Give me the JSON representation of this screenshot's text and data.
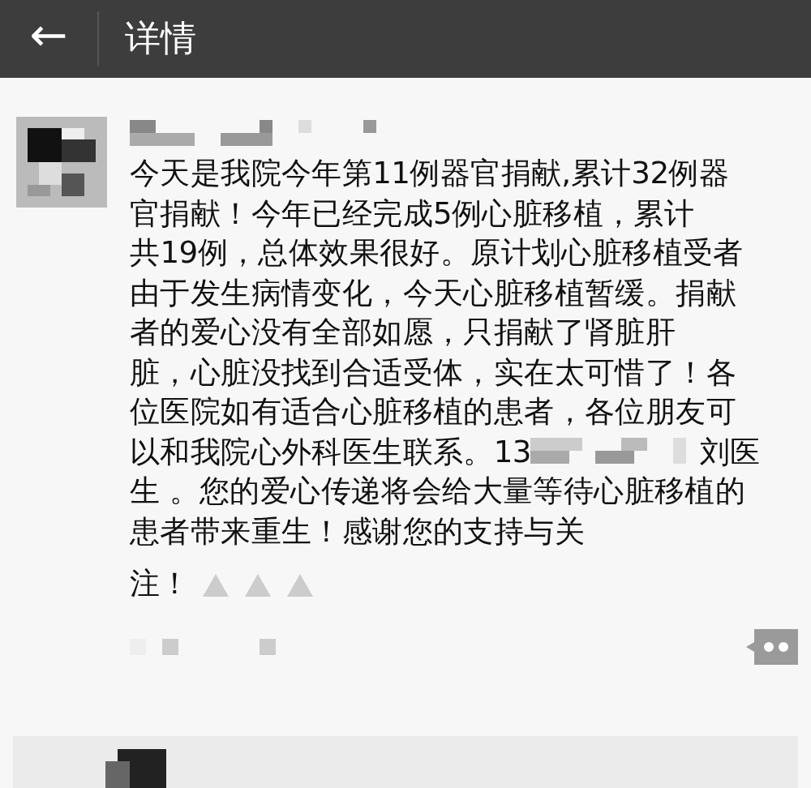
{
  "header": {
    "back": "←",
    "title": "详情"
  },
  "post": {
    "lines": [
      {
        "text": "今天是我院今年第11例器官捐献,累计32例器"
      },
      {
        "text": "官捐献！今年已经完成5例心脏移植，累计"
      },
      {
        "text": "共19例，总体效果很好。原计划心脏移植受者"
      },
      {
        "text": "由于发生病情变化，今天心脏移植暂缓。捐献"
      },
      {
        "text": "者的爱心没有全部如愿，只捐献了肾脏肝"
      },
      {
        "text": "脏，心脏没找到合适受体，实在太可惜了！各"
      },
      {
        "text": "位医院如有适合心脏移植的患者，各位朋友可"
      },
      {
        "text": "以和我院心外科医生联系。13",
        "after": "刘医"
      },
      {
        "text": "生 。您的爱心传递将会给大量等待心脏移植的"
      },
      {
        "text": "患者带来重生！感谢您的支持与关"
      }
    ],
    "last_line": "注！"
  }
}
